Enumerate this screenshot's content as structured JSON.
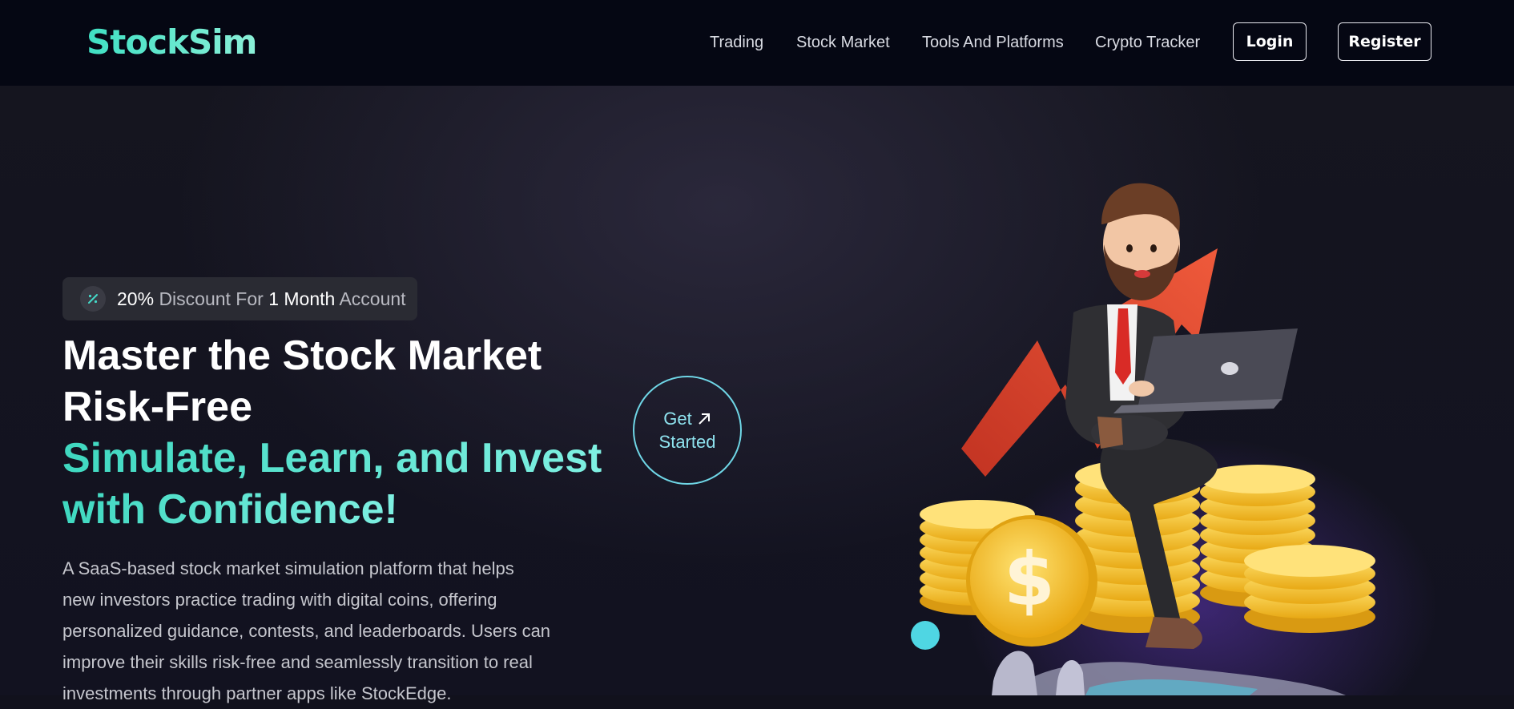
{
  "brand": {
    "logo": "StockSim"
  },
  "nav": {
    "links": [
      "Trading",
      "Stock Market",
      "Tools And Platforms",
      "Crypto Tracker"
    ],
    "login": "Login",
    "register": "Register"
  },
  "hero": {
    "badge": {
      "icon": "percent-icon",
      "percent": "20%",
      "text1": "Discount For",
      "duration": "1 Month",
      "text2": "Account"
    },
    "headline_line1": "Master the Stock Market",
    "headline_line2": "Risk-Free",
    "headline_line3": "Simulate, Learn, and Invest",
    "headline_line4": "with Confidence!",
    "description": "A SaaS-based stock market simulation platform that helps new investors practice trading with digital coins, offering personalized guidance, contests, and leaderboards. Users can improve their skills risk-free and seamlessly transition to real investments through partner apps like StockEdge.",
    "cta_line1": "Get",
    "cta_line2": "Started",
    "cta_icon": "arrow-up-right-icon"
  },
  "colors": {
    "accent": "#3fd8c0",
    "background": "#11111c",
    "nav_background": "#050713",
    "arrow_red": "#e0442f",
    "coin_gold": "#f5c531"
  }
}
